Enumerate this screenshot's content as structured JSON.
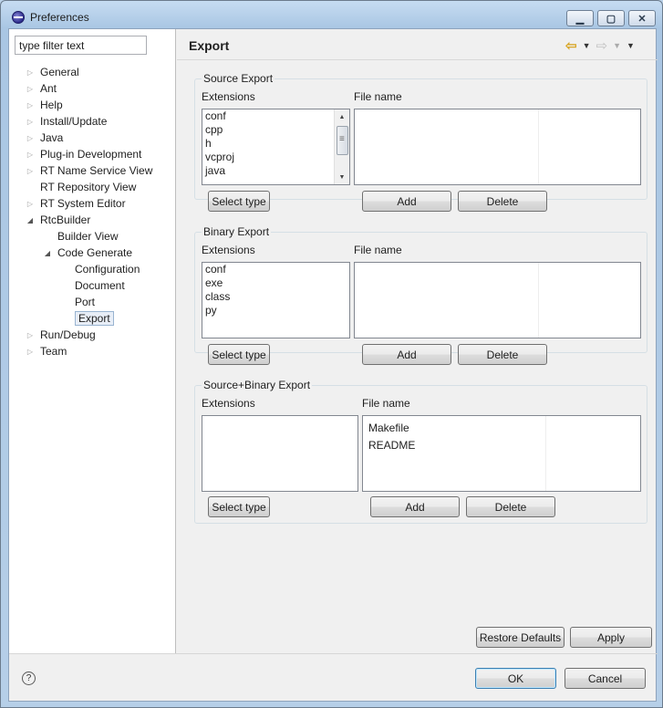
{
  "window": {
    "title": "Preferences"
  },
  "left": {
    "filter_placeholder": "type filter text",
    "tree": [
      {
        "label": "General",
        "level": 0,
        "expander": "collapsed"
      },
      {
        "label": "Ant",
        "level": 0,
        "expander": "collapsed"
      },
      {
        "label": "Help",
        "level": 0,
        "expander": "collapsed"
      },
      {
        "label": "Install/Update",
        "level": 0,
        "expander": "collapsed"
      },
      {
        "label": "Java",
        "level": 0,
        "expander": "collapsed"
      },
      {
        "label": "Plug-in Development",
        "level": 0,
        "expander": "collapsed"
      },
      {
        "label": "RT Name Service View",
        "level": 0,
        "expander": "collapsed"
      },
      {
        "label": "RT Repository View",
        "level": 0,
        "expander": "none"
      },
      {
        "label": "RT System Editor",
        "level": 0,
        "expander": "collapsed"
      },
      {
        "label": "RtcBuilder",
        "level": 0,
        "expander": "expanded"
      },
      {
        "label": "Builder View",
        "level": 1,
        "expander": "none"
      },
      {
        "label": "Code Generate",
        "level": 1,
        "expander": "expanded"
      },
      {
        "label": "Configuration",
        "level": 2,
        "expander": "none"
      },
      {
        "label": "Document",
        "level": 2,
        "expander": "none"
      },
      {
        "label": "Port",
        "level": 2,
        "expander": "none"
      },
      {
        "label": "Export",
        "level": 2,
        "expander": "none",
        "selected": true
      },
      {
        "label": "Run/Debug",
        "level": 0,
        "expander": "collapsed"
      },
      {
        "label": "Team",
        "level": 0,
        "expander": "collapsed"
      }
    ]
  },
  "right": {
    "title": "Export",
    "groups": [
      {
        "title": "Source Export",
        "ext_label": "Extensions",
        "file_label": "File name",
        "extensions": [
          "conf",
          "cpp",
          "h",
          "vcproj",
          "java"
        ],
        "files": [],
        "select_type": "Select type",
        "add": "Add",
        "delete": "Delete"
      },
      {
        "title": "Binary Export",
        "ext_label": "Extensions",
        "file_label": "File name",
        "extensions": [
          "conf",
          "exe",
          "class",
          "py"
        ],
        "files": [],
        "select_type": "Select type",
        "add": "Add",
        "delete": "Delete"
      },
      {
        "title": "Source+Binary Export",
        "ext_label": "Extensions",
        "file_label": "File name",
        "extensions": [],
        "files": [
          "Makefile",
          "README"
        ],
        "select_type": "Select type",
        "add": "Add",
        "delete": "Delete"
      }
    ],
    "restore_defaults": "Restore Defaults",
    "apply": "Apply"
  },
  "footer": {
    "ok": "OK",
    "cancel": "Cancel"
  }
}
